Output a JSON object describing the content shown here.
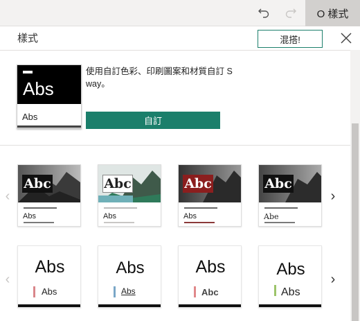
{
  "toolbar": {
    "undo_icon": "undo-icon",
    "redo_icon": "redo-icon",
    "styles_tab_label": "O 樣式"
  },
  "pane": {
    "title": "樣式",
    "remix_label": "混搭!",
    "close_icon": "close-icon"
  },
  "current_style": {
    "preview_heading": "Abs",
    "preview_body": "Abs",
    "description": "使用自訂色彩、印刷圖案和材質自訂 S way。",
    "customize_label": "自訂"
  },
  "navigation": {
    "prev_glyph": "‹",
    "next_glyph": "›"
  },
  "styles_row1": [
    {
      "heading": "Abc",
      "label": "Abs",
      "accent": "#7a7a7a"
    },
    {
      "heading": "Abc",
      "label": "Abs",
      "accent": "#c8c6c4"
    },
    {
      "heading": "Abc",
      "label": "Abs",
      "accent": "#8b3a3a"
    },
    {
      "heading": "Abc",
      "label": "Abe",
      "accent": "#7a7a7a"
    }
  ],
  "styles_row2": [
    {
      "heading": "Abs",
      "label": "Abs",
      "accent": "#d9868a"
    },
    {
      "heading": "Abs",
      "label": "Abs",
      "accent": "#7aa7c7"
    },
    {
      "heading": "Abs",
      "label": "Abc",
      "accent": "#e0888a"
    },
    {
      "heading": "Abs",
      "label": "Abs",
      "accent": "#9cc46a"
    }
  ],
  "colors": {
    "accent_green": "#1b7f6b",
    "toolbar_bg": "#f3f2f1",
    "active_tab_bg": "#d2d0ce"
  }
}
